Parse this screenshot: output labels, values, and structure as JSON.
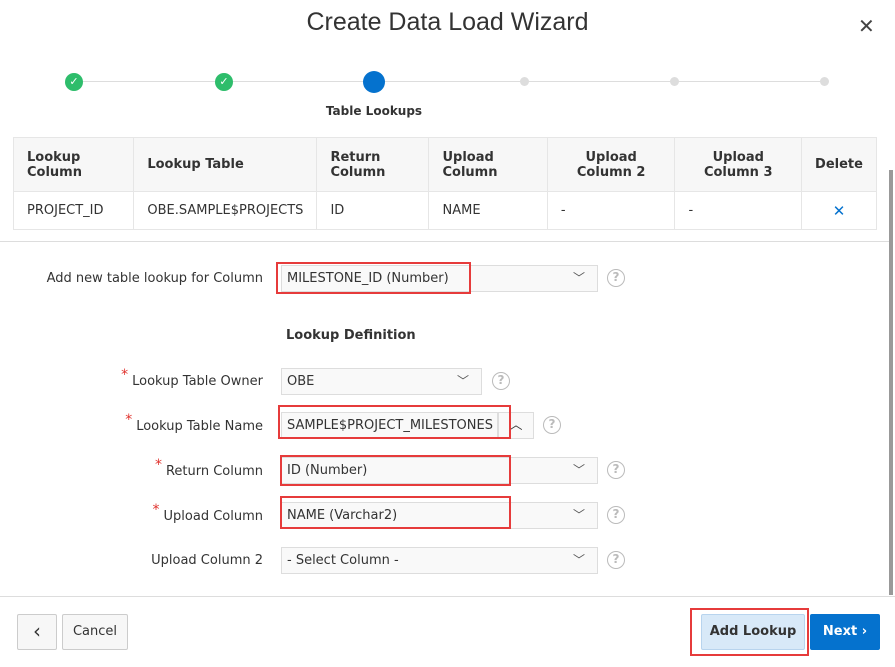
{
  "dialog": {
    "title": "Create Data Load Wizard",
    "close_icon": "close-icon"
  },
  "wizard": {
    "current_step_label": "Table Lookups",
    "steps_total": 6,
    "current_step": 3
  },
  "table": {
    "headers": [
      "Lookup Column",
      "Lookup Table",
      "Return Column",
      "Upload Column",
      "Upload Column 2",
      "Upload Column 3",
      "Delete"
    ],
    "rows": [
      {
        "lookup_column": "PROJECT_ID",
        "lookup_table": "OBE.SAMPLE$PROJECTS",
        "return_column": "ID",
        "upload_column": "NAME",
        "upload_column_2": "-",
        "upload_column_3": "-",
        "delete": "✕"
      }
    ]
  },
  "form": {
    "add_lookup_label": "Add new table lookup for Column",
    "add_lookup_value": "MILESTONE_ID (Number)",
    "section_heading": "Lookup Definition",
    "owner_label": "Lookup Table Owner",
    "owner_value": "OBE",
    "table_name_label": "Lookup Table Name",
    "table_name_value": "SAMPLE$PROJECT_MILESTONES (ta",
    "return_label": "Return Column",
    "return_value": "ID (Number)",
    "upload_label": "Upload Column",
    "upload_value": "NAME (Varchar2)",
    "upload2_label": "Upload Column 2",
    "upload2_value": "- Select Column -",
    "required_mark": "*",
    "help": "?"
  },
  "footer": {
    "back": "‹",
    "cancel": "Cancel",
    "add_lookup": "Add Lookup",
    "next": "Next"
  },
  "colors": {
    "accent": "#0572ce",
    "success": "#2ebd6b",
    "highlight": "#e63b3b"
  }
}
